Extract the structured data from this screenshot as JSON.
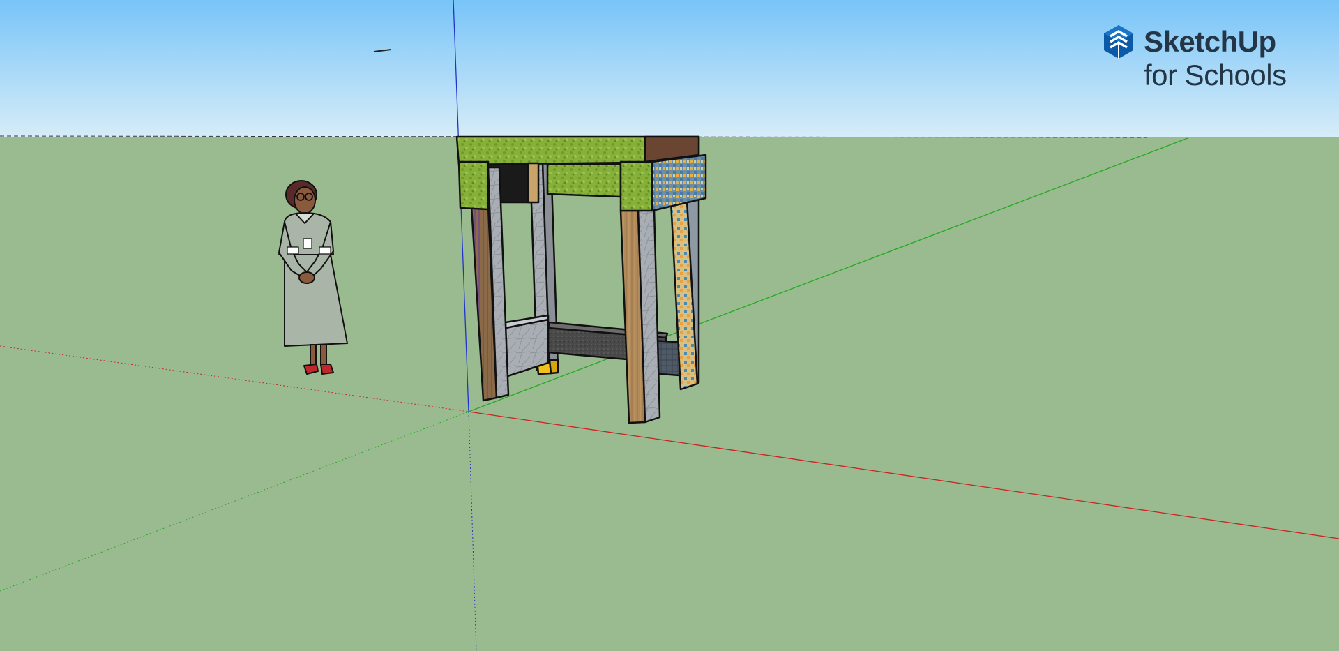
{
  "app": {
    "brand_name": "SketchUp",
    "brand_sub": "for Schools",
    "brand_icon": "sketchup-logo-icon"
  },
  "scene": {
    "sky_color_top": "#78c4f8",
    "sky_color_bottom": "#d6ecf8",
    "ground_color": "#9abb8f",
    "axis_red": "#cc2222",
    "axis_green": "#22aa22",
    "axis_blue": "#2233cc",
    "model": "stool",
    "figure": "scale-figure-person"
  }
}
